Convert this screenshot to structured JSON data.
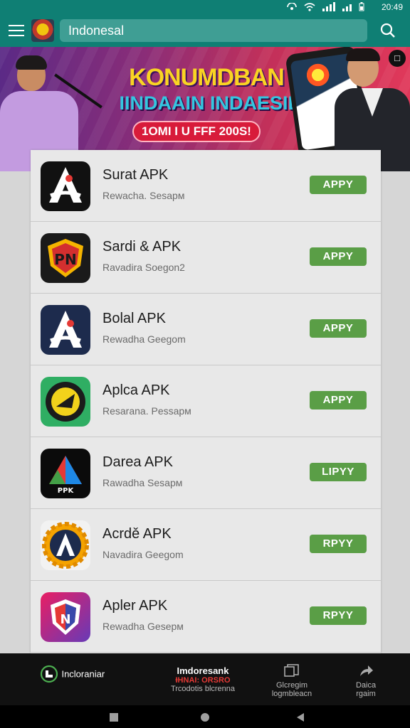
{
  "status": {
    "time": "20:49"
  },
  "header": {
    "search_value": "Indonesal",
    "menu_icon": "menu-icon",
    "search_icon": "search-icon"
  },
  "banner": {
    "headline": "KONUMDBAN",
    "subline": "IINDAAIN INDAESIE",
    "pill": "1OMI I U FFF 200S!"
  },
  "apps": [
    {
      "name": "Surat APK",
      "sub": "Rewacha. Sesapм",
      "action": "APPY",
      "icon": "app-a-icon"
    },
    {
      "name": "Sardi & APK",
      "sub": "Ravadira Soegon2",
      "action": "APPY",
      "icon": "shield-icon"
    },
    {
      "name": "Bolal APK",
      "sub": "Rewadha Geegom",
      "action": "APPY",
      "icon": "app-a-icon"
    },
    {
      "name": "Aplca APK",
      "sub": "Resarana. Pessapм",
      "action": "APPY",
      "icon": "badge-icon"
    },
    {
      "name": "Darea APK",
      "sub": "Rawadha Sesapм",
      "action": "LIPYY",
      "icon": "prism-icon"
    },
    {
      "name": "Acrdě APK",
      "sub": "Navadira Geegom",
      "action": "RPYY",
      "icon": "gear-icon"
    },
    {
      "name": "Apler APK",
      "sub": "Rewadha Gesepм",
      "action": "RPYY",
      "icon": "shield-icon"
    }
  ],
  "bottom_nav": [
    {
      "label": "Incloraniar",
      "icon": "home-icon"
    },
    {
      "label": "Imdoresank",
      "sub1": "ƗHNAI: ORSRO",
      "sub2": "Trcodotis blcrenna"
    },
    {
      "label": "Glcregim",
      "sub": "logmbleacn",
      "icon": "copy-icon"
    },
    {
      "label": "Daica",
      "sub": "rgaim",
      "icon": "share-icon"
    }
  ],
  "colors": {
    "primary": "#0f7f74",
    "apply": "#5a9e46",
    "nav_bg": "#111111"
  }
}
